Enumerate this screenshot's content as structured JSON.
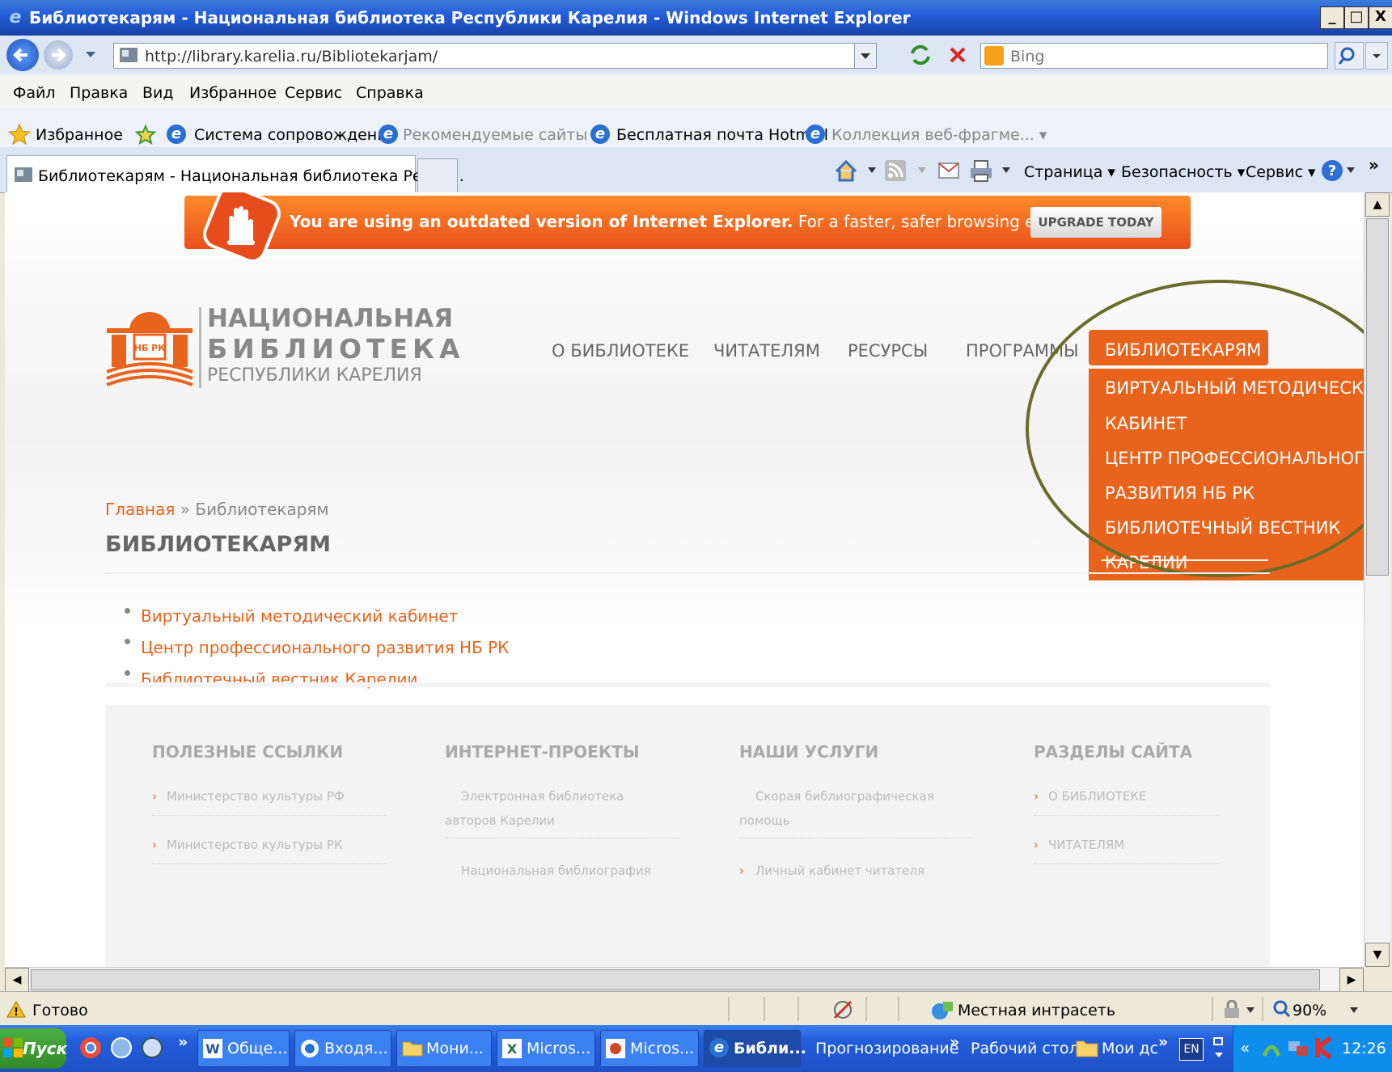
{
  "window": {
    "title": "Библиотекарям - Национальная библиотека Республики Карелия - Windows Internet Explorer",
    "controls": [
      "_",
      "□",
      "X"
    ]
  },
  "address_bar": {
    "url": "http://library.karelia.ru/Bibliotekarjam/",
    "search_placeholder": "Bing"
  },
  "menu": [
    "Файл",
    "Правка",
    "Вид",
    "Избранное",
    "Сервис",
    "Справка"
  ],
  "favorites_bar": {
    "favorites": "Избранное",
    "items": [
      "Система сопровождения",
      "Рекомендуемые сайты ▾",
      "Бесплатная почта Hotmail",
      "Коллекция веб-фрагме... ▾"
    ]
  },
  "tab": {
    "title": "Библиотекарям - Национальная библиотека Респу..."
  },
  "command_bar": [
    "Страница ▾",
    "Безопасность ▾",
    "Сервис ▾"
  ],
  "banner": {
    "bold": "You are using an outdated version of Internet Explorer.",
    "text": " For a faster, safer browsing experience",
    "button": "UPGRADE TODAY"
  },
  "logo": {
    "line1": "НАЦИОНАЛЬНАЯ",
    "line2": "БИБЛИОТЕКА",
    "line3": "РЕСПУБЛИКИ КАРЕЛИЯ",
    "mark_text": "НБ РК"
  },
  "nav": {
    "items": [
      "О БИБЛИОТЕКЕ",
      "ЧИТАТЕЛЯМ",
      "РЕСУРСЫ",
      "ПРОГРАММЫ"
    ],
    "active": "БИБЛИОТЕКАРЯМ",
    "dropdown": [
      "ВИРТУАЛЬНЫЙ МЕТОДИЧЕСКИЙ",
      "КАБИНЕТ",
      "ЦЕНТР ПРОФЕССИОНАЛЬНОГО",
      "РАЗВИТИЯ НБ РК",
      "БИБЛИОТЕЧНЫЙ ВЕСТНИК",
      "КАРЕЛИИ"
    ]
  },
  "breadcrumb": {
    "home": "Главная",
    "sep": " » ",
    "current": "Библиотекарям"
  },
  "page_title": "БИБЛИОТЕКАРЯМ",
  "links": [
    "Виртуальный методический кабинет",
    "Центр профессионального развития НБ РК",
    "Библиотечный вестник Карелии"
  ],
  "footer": {
    "columns": [
      {
        "heading": "ПОЛЕЗНЫЕ ССЫЛКИ",
        "items": [
          "Министерство культуры РФ",
          "Министерство культуры РК"
        ]
      },
      {
        "heading": "ИНТЕРНЕТ-ПРОЕКТЫ",
        "items": [
          "Электронная библиотека",
          "авторов Карелии",
          "Национальная библиография"
        ]
      },
      {
        "heading": "НАШИ УСЛУГИ",
        "items": [
          "Скорая библиографическая",
          "помощь",
          "Личный кабинет читателя"
        ]
      },
      {
        "heading": "РАЗДЕЛЫ САЙТА",
        "items": [
          "О БИБЛИОТЕКЕ",
          "ЧИТАТЕЛЯМ"
        ]
      }
    ]
  },
  "status_bar": {
    "text": "Готово",
    "zone": "Местная интрасеть",
    "zoom": "90%"
  },
  "taskbar": {
    "start": "Пуск",
    "tasks": [
      "Обще...",
      "Входя...",
      "Мони...",
      "Micros...",
      "Micros...",
      "Библи..."
    ],
    "toolbars": [
      "Прогнозирование",
      "Рабочий стол",
      "Мои дс"
    ],
    "lang": "EN",
    "clock": "12:26",
    "more": "»"
  }
}
